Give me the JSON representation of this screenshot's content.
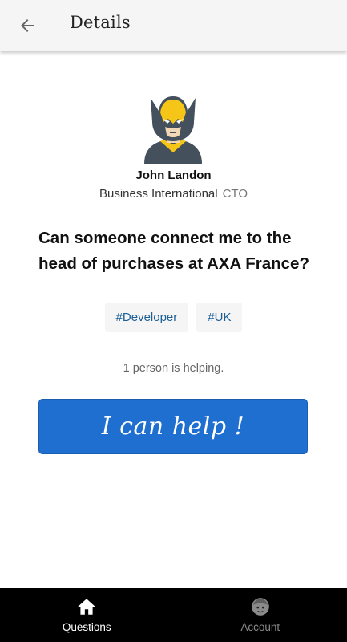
{
  "appbar": {
    "title": "Details",
    "back_icon": "arrow-left-icon"
  },
  "profile": {
    "name": "John Landon",
    "company": "Business International",
    "role": "CTO",
    "avatar_icon": "superhero-avatar-icon"
  },
  "question": {
    "text": "Can someone connect me to the head of purchases at AXA France?"
  },
  "tags": [
    {
      "label": "#Developer"
    },
    {
      "label": "#UK"
    }
  ],
  "helping_status": "1 person is helping.",
  "help_button": {
    "label": "I can help !"
  },
  "bottom_nav": {
    "items": [
      {
        "label": "Questions",
        "icon": "home-icon",
        "active": true
      },
      {
        "label": "Account",
        "icon": "account-face-icon",
        "active": false
      }
    ]
  },
  "colors": {
    "accent": "#1e6fcf",
    "tag_text": "#1b5f96",
    "nav_background": "#000000",
    "appbar_background": "#f5f5f5"
  }
}
